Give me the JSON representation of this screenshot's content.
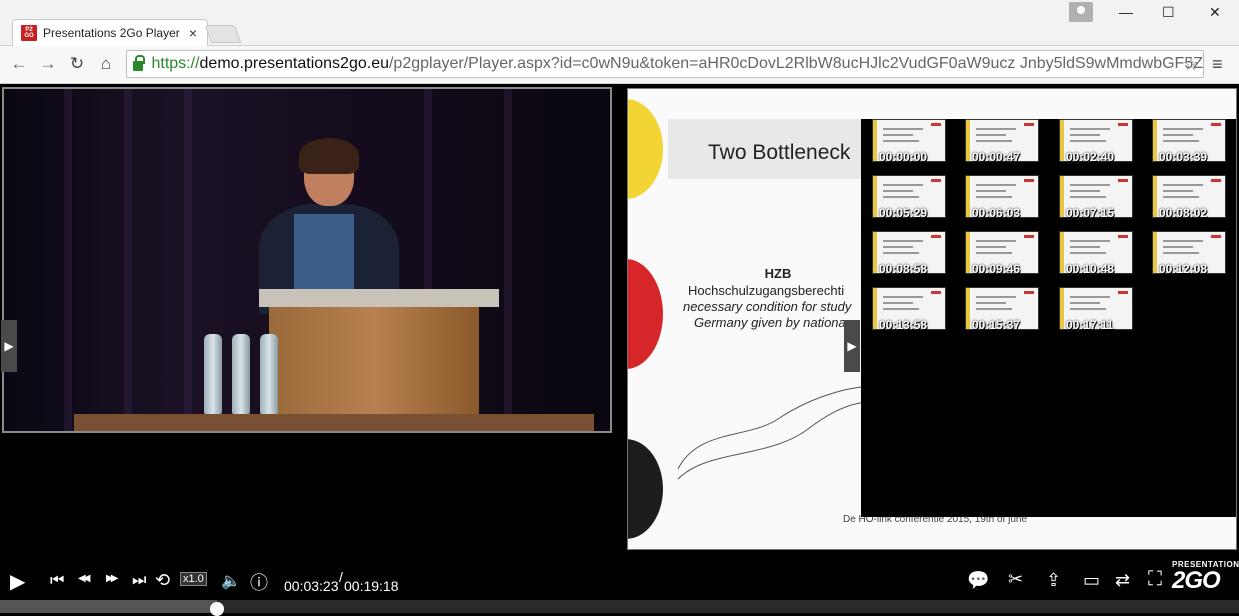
{
  "browser": {
    "tab_title": "Presentations 2Go Player",
    "tab_close": "×",
    "favicon_text": "P2 GO",
    "url_scheme": "https://",
    "url_host": "demo.presentations2go.eu",
    "url_path": "/p2gplayer/Player.aspx?id=c0wN9u&token=aHR0cDovL2RlbW8ucHJlc2VudGF0aW9ucz Jnby5ldS9wMmdwbGF5Z",
    "window_controls": {
      "minimize": "—",
      "maximize": "☐",
      "close": "✕"
    }
  },
  "slide": {
    "title": "Two Bottleneck",
    "heading": "HZB",
    "line1": "Hochschulzugangsberechti",
    "line2": "necessary condition for study",
    "line3": "Germany given by nationa",
    "footer": "De HO-link conferentie 2015, 19th of june"
  },
  "thumbnails": [
    "00:00:00",
    "00:00:47",
    "00:02:40",
    "00:03:39",
    "00:05:29",
    "00:06:03",
    "00:07:15",
    "00:08:02",
    "00:08:58",
    "00:09:46",
    "00:10:48",
    "00:12:08",
    "00:13:58",
    "00:15:37",
    "00:17:11"
  ],
  "player": {
    "speed_label": "x1.0",
    "current_time": "00:03:23",
    "separator": "/",
    "total_time": "00:19:18",
    "progress_fraction": 0.175,
    "brand_small": "PRESENTATIONS",
    "brand_big": "2GO"
  },
  "icons": {
    "play": "▶",
    "prev_chapter": "⏮",
    "rewind": "◀◀",
    "forward": "▶▶",
    "next_chapter": "⏭",
    "loop": "⟲",
    "volume": "🔈",
    "info": "ⓘ",
    "chat": "💬",
    "cut": "✂",
    "share": "⇪",
    "layout": "▭",
    "swap": "⇄",
    "fullscreen": "⛶"
  },
  "colors": {
    "accent": "#2a8a2a",
    "player_bg": "#000000"
  }
}
